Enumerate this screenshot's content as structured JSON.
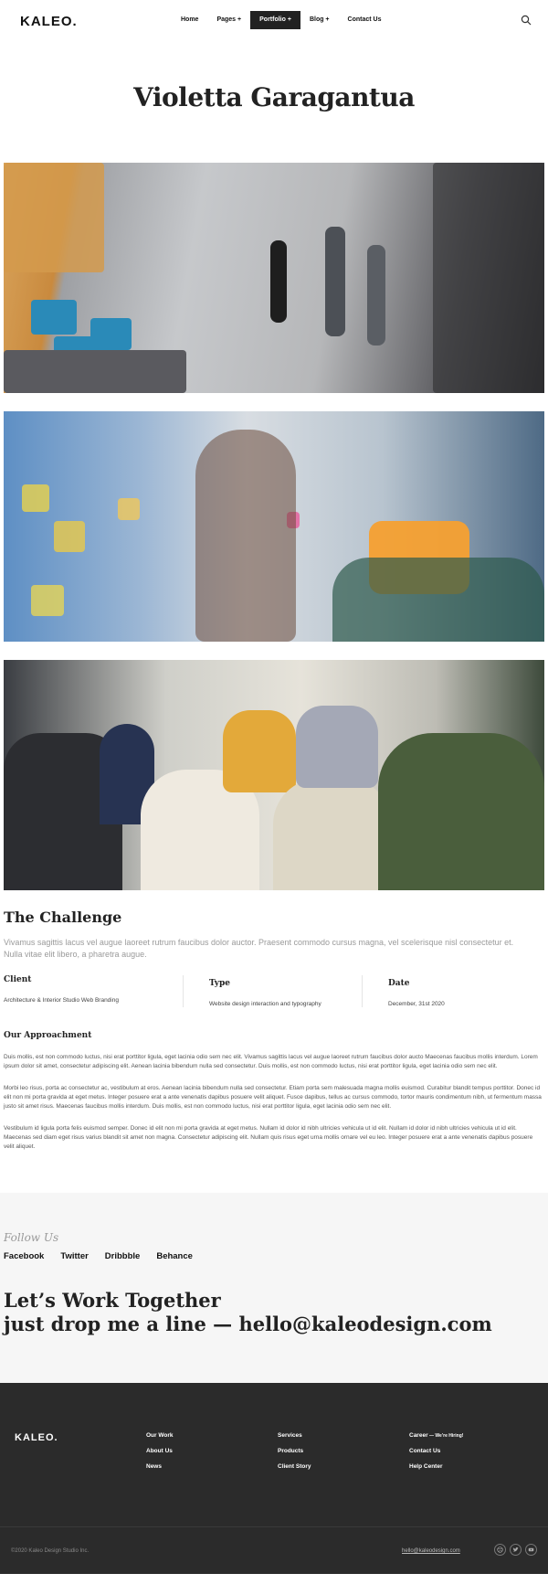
{
  "header": {
    "logo": "KALEO.",
    "nav": [
      {
        "label": "Home"
      },
      {
        "label": "Pages +"
      },
      {
        "label": "Portfolio +"
      },
      {
        "label": "Blog +"
      },
      {
        "label": "Contact Us"
      }
    ],
    "search_icon": "search-icon"
  },
  "page_title": "Violetta Garagantua",
  "challenge": {
    "title": "The Challenge",
    "text": "Vivamus sagittis lacus vel augue laoreet rutrum faucibus dolor auctor. Praesent commodo cursus magna, vel scelerisque nisl consectetur et. Nulla vitae elit libero, a pharetra augue."
  },
  "meta": {
    "client_label": "Client",
    "client_value": "Architecture & Interior Studio Web Branding",
    "type_label": "Type",
    "type_value": "Website design interaction and typography",
    "date_label": "Date",
    "date_value": "December, 31st 2020"
  },
  "approach": {
    "title": "Our Approachment",
    "p1": "Duis mollis, est non commodo luctus, nisi erat porttitor ligula, eget lacinia odio sem nec elit. Vivamus sagittis lacus vel augue laoreet rutrum faucibus dolor aucto Maecenas faucibus mollis interdum. Lorem ipsum dolor sit amet, consectetur adipiscing elit. Aenean lacinia bibendum nulla sed consectetur. Duis mollis, est non commodo luctus, nisi erat porttitor ligula, eget lacinia odio sem nec elit.",
    "p2": "Morbi leo risus, porta ac consectetur ac, vestibulum at eros. Aenean lacinia bibendum nulla sed consectetur. Etiam porta sem malesuada magna mollis euismod. Curabitur blandit tempus porttitor. Donec id elit non mi porta gravida at eget metus. Integer posuere erat a ante venenatis dapibus posuere velit aliquet. Fusce dapibus, tellus ac cursus commodo, tortor mauris condimentum nibh, ut fermentum massa justo sit amet risus. Maecenas faucibus mollis interdum. Duis mollis, est non commodo luctus, nisi erat porttitor ligula, eget lacinia odio sem nec elit.",
    "p3": "Vestibulum id ligula porta felis euismod semper. Donec id elit non mi porta gravida at eget metus. Nullam id dolor id nibh ultricies vehicula ut id elit. Nullam id dolor id nibh ultricies vehicula ut id elit. Maecenas sed diam eget risus varius blandit sit amet non magna. Consectetur adipiscing elit. Nullam quis risus eget urna mollis ornare vel eu leo. Integer posuere erat a ante venenatis dapibus posuere velit aliquet."
  },
  "follow": {
    "title": "Follow Us",
    "links": [
      {
        "label": "Facebook"
      },
      {
        "label": "Twitter"
      },
      {
        "label": "Dribbble"
      },
      {
        "label": "Behance"
      }
    ],
    "line1": "Let’s Work Together",
    "line2": "just drop me a line —  hello@kaleodesign.com"
  },
  "footer": {
    "logo": "KALEO.",
    "col1": [
      "Our Work",
      "About Us",
      "News"
    ],
    "col2": [
      "Services",
      "Products",
      "Client Story"
    ],
    "col3_career": "Career",
    "col3_career_sub": " — We’re Hiring!",
    "col3": [
      "Contact Us",
      "Help Center"
    ],
    "copyright": "©2020 Kaleo Design Studio Inc.",
    "email": "hello@kaleodesign.com",
    "social_icons": [
      "dribbble-icon",
      "twitter-icon",
      "youtube-icon"
    ]
  }
}
